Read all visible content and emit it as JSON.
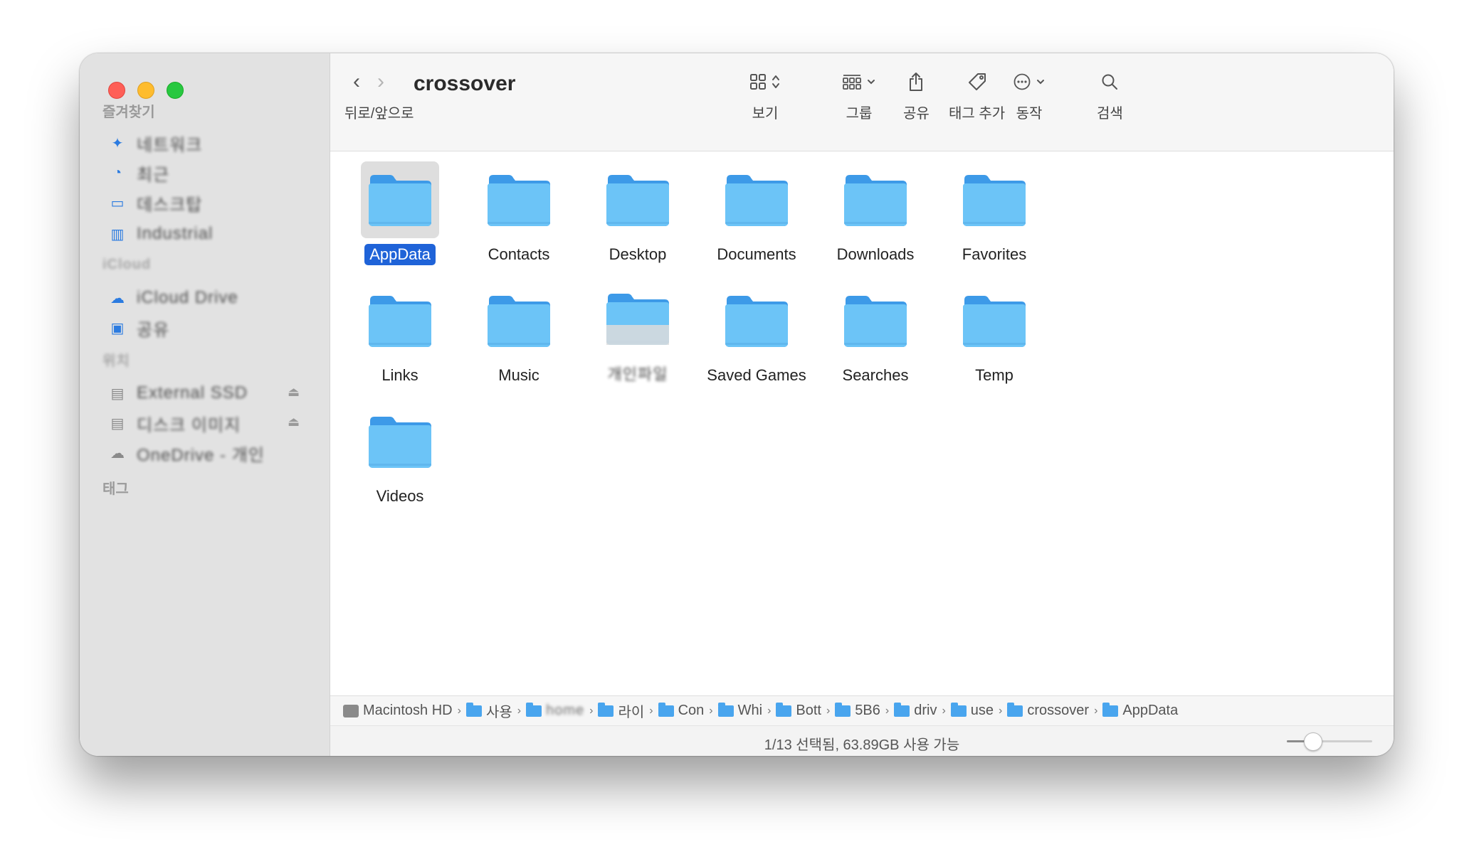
{
  "window": {
    "title": "crossover",
    "nav_label": "뒤로/앞으로"
  },
  "toolbar": {
    "view_label": "보기",
    "group_label": "그룹",
    "share_label": "공유",
    "tag_label": "태그 추가",
    "action_label": "동작",
    "search_label": "검색"
  },
  "sidebar": {
    "favorites_header": "즐겨찾기",
    "favorites": [
      {
        "label": "네트워크",
        "icon": "airdrop-icon"
      },
      {
        "label": "최근",
        "icon": "recents-icon"
      },
      {
        "label": "데스크탑",
        "icon": "desktop-icon"
      },
      {
        "label": "Industrial",
        "icon": "applications-icon"
      }
    ],
    "icloud_header": "iCloud",
    "icloud": [
      {
        "label": "iCloud Drive",
        "icon": "icloud-icon"
      },
      {
        "label": "공유",
        "icon": "shared-icon"
      }
    ],
    "locations_header": "위치",
    "locations": [
      {
        "label": "External SSD",
        "icon": "disk-icon"
      },
      {
        "label": "디스크 이미지",
        "icon": "disk-icon"
      },
      {
        "label": "OneDrive - 개인",
        "icon": "cloud-icon"
      }
    ],
    "tags_header": "태그"
  },
  "folders": [
    {
      "name": "AppData",
      "selected": true
    },
    {
      "name": "Contacts"
    },
    {
      "name": "Desktop"
    },
    {
      "name": "Documents"
    },
    {
      "name": "Downloads"
    },
    {
      "name": "Favorites"
    },
    {
      "name": "Links"
    },
    {
      "name": "Music"
    },
    {
      "name": "개인파일",
      "redacted": true
    },
    {
      "name": "Saved Games"
    },
    {
      "name": "Searches"
    },
    {
      "name": "Temp"
    },
    {
      "name": "Videos"
    }
  ],
  "pathbar": [
    {
      "label": "Macintosh HD",
      "type": "disk"
    },
    {
      "label": "사용"
    },
    {
      "label": "home",
      "redacted": true
    },
    {
      "label": "라이"
    },
    {
      "label": "Con"
    },
    {
      "label": "Whi"
    },
    {
      "label": "Bott"
    },
    {
      "label": "5B6"
    },
    {
      "label": "driv"
    },
    {
      "label": "use"
    },
    {
      "label": "crossover"
    },
    {
      "label": "AppData"
    }
  ],
  "status": {
    "text": "1/13 선택됨, 63.89GB 사용 가능",
    "zoom_fraction": 0.25
  },
  "colors": {
    "folder_front": "#6cc4f7",
    "folder_back": "#3d9ae8",
    "selection": "#1f63d8",
    "sidebar_accent": "#2b7be0"
  }
}
